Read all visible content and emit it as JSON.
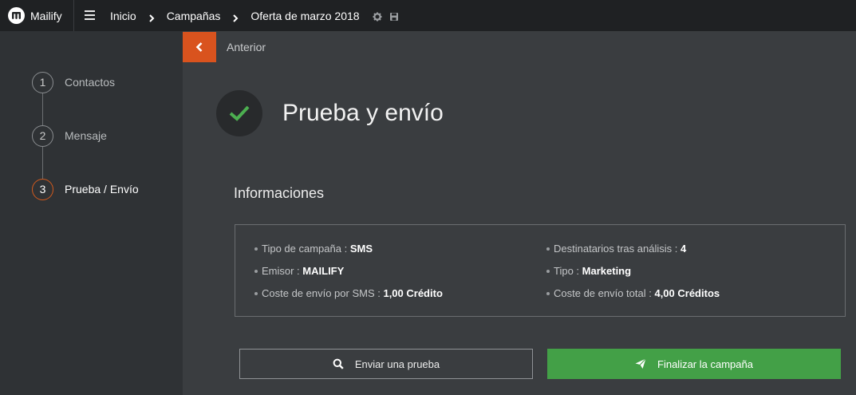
{
  "app": {
    "name": "Mailify",
    "logo_icon": "mailify-logo-icon"
  },
  "topbar": {
    "menu_icon": "hamburger-menu-icon",
    "breadcrumbs": [
      "Inicio",
      "Campañas",
      "Oferta de marzo 2018"
    ],
    "tools": [
      "gear-icon",
      "save-icon"
    ]
  },
  "sidebar": {
    "steps": [
      {
        "number": "1",
        "label": "Contactos",
        "active": false
      },
      {
        "number": "2",
        "label": "Mensaje",
        "active": false
      },
      {
        "number": "3",
        "label": "Prueba / Envío",
        "active": true
      }
    ]
  },
  "main": {
    "back_label": "Anterior",
    "title": "Prueba y envío",
    "section_title": "Informaciones",
    "info": {
      "left": [
        {
          "label": "Tipo de campaña : ",
          "value": "SMS"
        },
        {
          "label": "Emisor : ",
          "value": "MAILIFY"
        },
        {
          "label": "Coste de envío por SMS : ",
          "value": "1,00 Crédito"
        }
      ],
      "right": [
        {
          "label": "Destinatarios tras análisis : ",
          "value": "4"
        },
        {
          "label": "Tipo : ",
          "value": "Marketing"
        },
        {
          "label": "Coste de envío total : ",
          "value": "4,00 Créditos"
        }
      ]
    },
    "buttons": {
      "test_label": "Enviar una prueba",
      "finish_label": "Finalizar la campaña"
    }
  },
  "colors": {
    "accent_orange": "#d9531e",
    "success_green": "#43a047",
    "check_green": "#4caf50"
  }
}
